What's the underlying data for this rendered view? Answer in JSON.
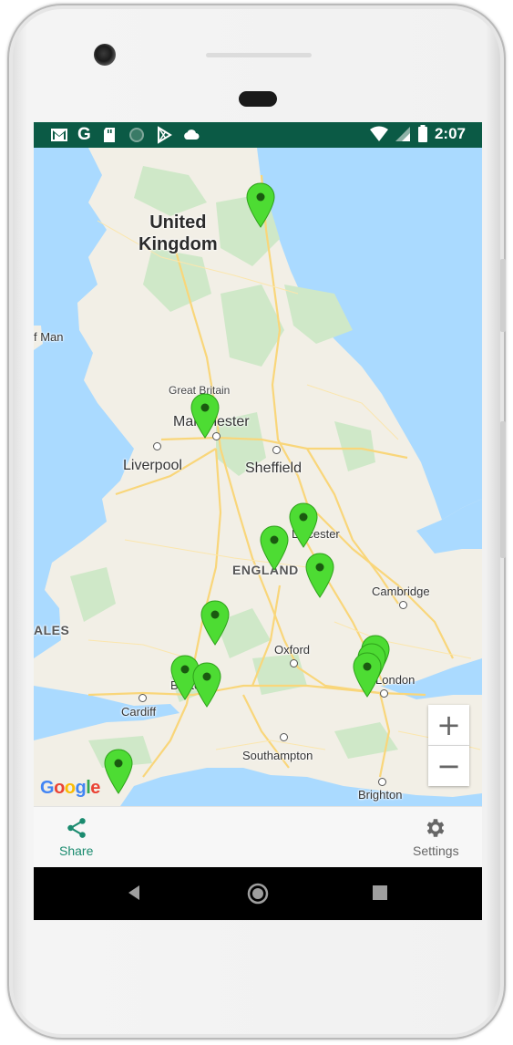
{
  "status_bar": {
    "time": "2:07",
    "left_icons": [
      "gmail-icon",
      "google-icon",
      "sd-card-icon",
      "sync-circle-icon",
      "play-store-icon",
      "cloud-icon"
    ],
    "right_icons": [
      "wifi-icon",
      "signal-icon",
      "battery-icon"
    ],
    "background": "#0b5a45"
  },
  "map": {
    "labels": {
      "country_top_1": "United",
      "country_top_2": "Kingdom",
      "isle_of_man": "f Man",
      "great_britain": "Great Britain",
      "manchester": "Manchester",
      "liverpool": "Liverpool",
      "sheffield": "Sheffield",
      "leicester": "Leicester",
      "england": "ENGLAND",
      "cambridge": "Cambridge",
      "wales": "ALES",
      "oxford": "Oxford",
      "bristol": "Bristol",
      "london": "London",
      "cardiff": "Cardiff",
      "southampton": "Southampton",
      "brighton": "Brighton"
    },
    "marker_color": "#4ddc33",
    "marker_count": 13,
    "zoom_in": "+",
    "zoom_out": "−",
    "attribution": "Google"
  },
  "bottom_nav": {
    "share_label": "Share",
    "share_color": "#1a8b6f",
    "settings_label": "Settings"
  },
  "system_nav": [
    "back-button",
    "home-button",
    "recents-button"
  ]
}
